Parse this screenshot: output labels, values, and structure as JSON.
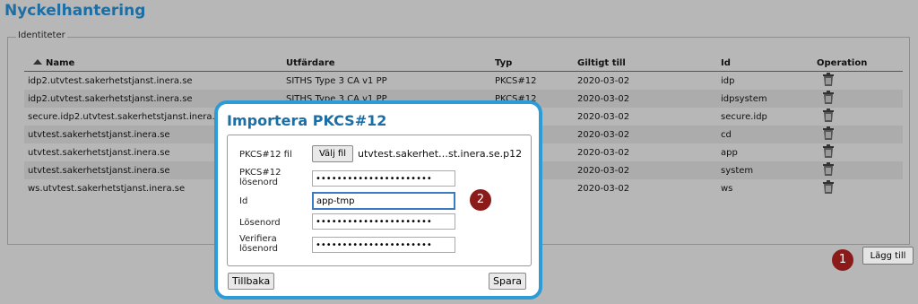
{
  "page": {
    "title": "Nyckelhantering"
  },
  "identities": {
    "legend": "Identiteter",
    "columns": [
      "Name",
      "Utfärdare",
      "Typ",
      "Giltigt till",
      "Id",
      "Operation"
    ],
    "rows": [
      {
        "name": "idp2.utvtest.sakerhetstjanst.inera.se",
        "issuer": "SITHS Type 3 CA v1 PP",
        "type": "PKCS#12",
        "valid": "2020-03-02",
        "id": "idp"
      },
      {
        "name": "idp2.utvtest.sakerhetstjanst.inera.se",
        "issuer": "SITHS Type 3 CA v1 PP",
        "type": "PKCS#12",
        "valid": "2020-03-02",
        "id": "idpsystem"
      },
      {
        "name": "secure.idp2.utvtest.sakerhetstjanst.inera.",
        "issuer": "",
        "type": "",
        "valid": "2020-03-02",
        "id": "secure.idp"
      },
      {
        "name": "utvtest.sakerhetstjanst.inera.se",
        "issuer": "",
        "type": "",
        "valid": "2020-03-02",
        "id": "cd"
      },
      {
        "name": "utvtest.sakerhetstjanst.inera.se",
        "issuer": "",
        "type": "",
        "valid": "2020-03-02",
        "id": "app"
      },
      {
        "name": "utvtest.sakerhetstjanst.inera.se",
        "issuer": "",
        "type": "",
        "valid": "2020-03-02",
        "id": "system"
      },
      {
        "name": "ws.utvtest.sakerhetstjanst.inera.se",
        "issuer": "",
        "type": "",
        "valid": "2020-03-02",
        "id": "ws"
      }
    ],
    "operation_icon": "trash-icon",
    "add_button": "Lägg till"
  },
  "markers": {
    "one": "1",
    "two": "2",
    "color": "#8b1b1b"
  },
  "dialog": {
    "title": "Importera PKCS#12",
    "border_color": "#2c9bd6",
    "file_label": "PKCS#12 fil",
    "file_button": "Välj fil",
    "file_name": "utvtest.sakerhet…st.inera.se.p12",
    "pkcs_password_label_1": "PKCS#12",
    "pkcs_password_label_2": "lösenord",
    "pkcs_password_value": "••••••••••••••••••••••",
    "id_label": "Id",
    "id_value": "app-tmp",
    "password_label": "Lösenord",
    "password_value": "••••••••••••••••••••••",
    "verify_label_1": "Verifiera",
    "verify_label_2": "lösenord",
    "verify_value": "••••••••••••••••••••••",
    "back_button": "Tillbaka",
    "save_button": "Spara"
  }
}
